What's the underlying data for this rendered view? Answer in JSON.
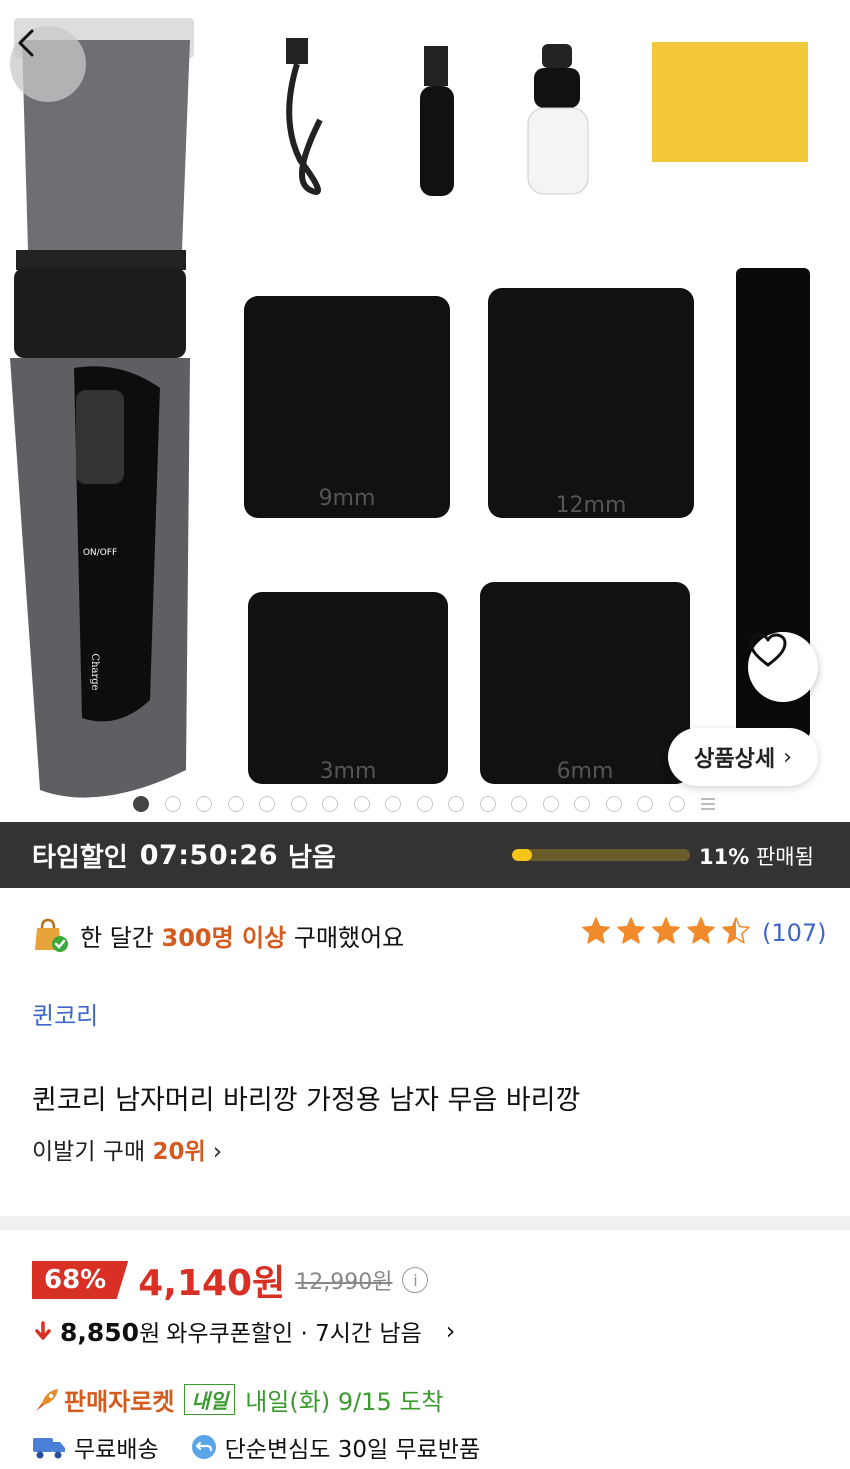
{
  "hero": {
    "comb_labels": [
      "9mm",
      "12mm",
      "3mm",
      "6mm"
    ],
    "clipper_switch_label": "ON/OFF",
    "clipper_charge_label": "Charge",
    "detail_button": "상품상세",
    "image_count": 18,
    "active_index": 0
  },
  "timer": {
    "label": "타임할인",
    "time": "07:50:26",
    "suffix": "남음",
    "sold_percent": "11%",
    "sold_label": "판매됨",
    "progress_fraction": 0.11
  },
  "purchase": {
    "prefix": "한 달간",
    "highlight": "300명 이상",
    "suffix": "구매했어요"
  },
  "rating": {
    "stars": 4.5,
    "count": "(107)"
  },
  "product": {
    "brand": "퀸코리",
    "title": "퀸코리 남자머리 바리깡 가정용 남자 무음 바리깡",
    "rank_prefix": "이발기 구매",
    "rank_value": "20위"
  },
  "price": {
    "discount": "68%",
    "sale": "4,140원",
    "original": "12,990원",
    "coupon_amount": "8,850",
    "coupon_unit": "원",
    "coupon_label": "와우쿠폰할인 · 7시간 남음"
  },
  "delivery": {
    "rocket": "판매자로켓",
    "tag": "내일",
    "arrival": "내일(화) 9/15 도착",
    "shipping": "무료배송",
    "returns": "단순변심도 30일 무료반품"
  },
  "colors": {
    "accent_orange": "#d45a1e",
    "link_blue": "#3e67c9",
    "price_red": "#d93025",
    "delivery_green": "#3a9a2e",
    "timer_bg": "#333334",
    "progress_yellow": "#f5c518"
  }
}
